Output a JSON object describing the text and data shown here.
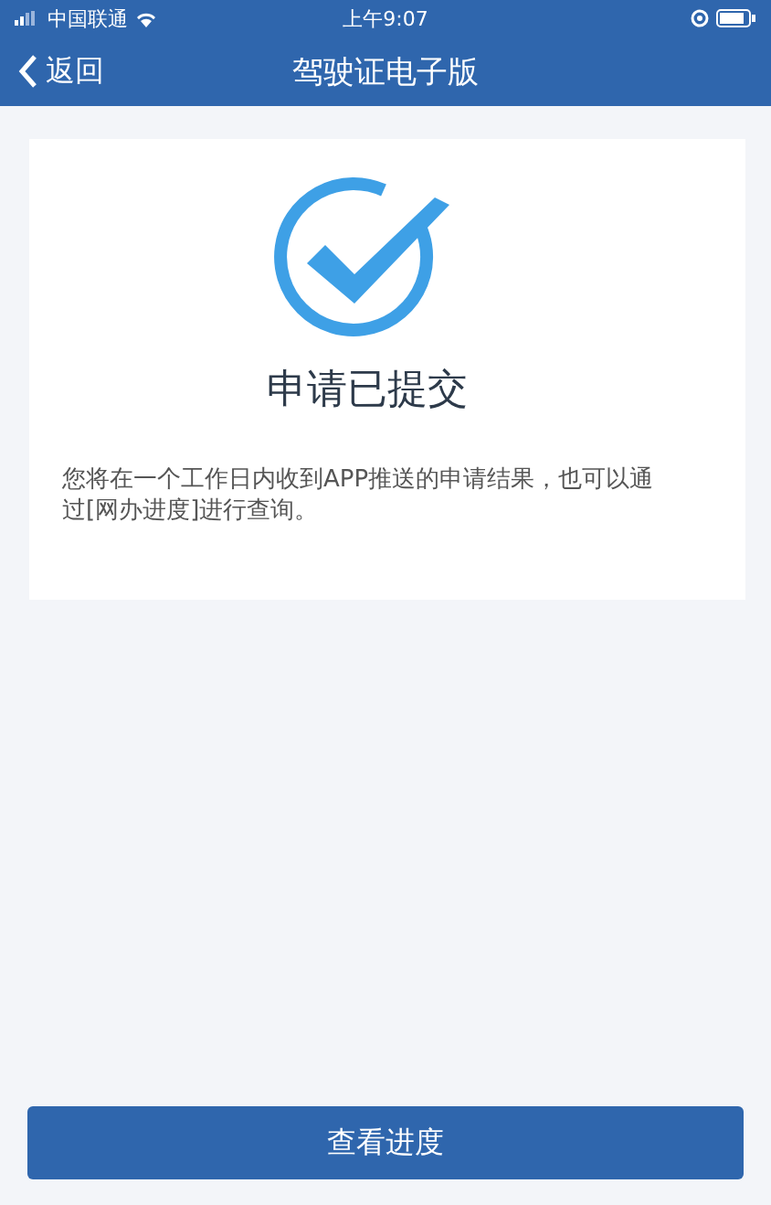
{
  "status_bar": {
    "carrier": "中国联通",
    "time": "上午9:07"
  },
  "nav": {
    "back": "返回",
    "title": "驾驶证电子版"
  },
  "result": {
    "title": "申请已提交",
    "message": "您将在一个工作日内收到APP推送的申请结果，也可以通过[网办进度]进行查询。"
  },
  "button": "查看进度"
}
